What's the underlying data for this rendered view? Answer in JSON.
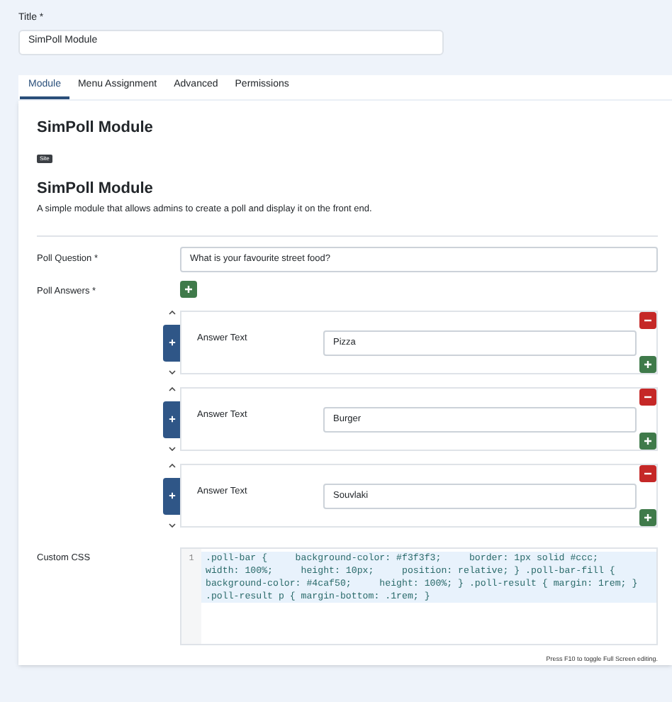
{
  "title_field": {
    "label": "Title *",
    "value": "SimPoll Module"
  },
  "tabs": [
    {
      "label": "Module",
      "selected": true
    },
    {
      "label": "Menu Assignment",
      "selected": false
    },
    {
      "label": "Advanced",
      "selected": false
    },
    {
      "label": "Permissions",
      "selected": false
    }
  ],
  "module": {
    "heading": "SimPoll Module",
    "badge": "Site",
    "subheading": "SimPoll Module",
    "description": "A simple module that allows admins to create a poll and display it on the front end."
  },
  "poll_question": {
    "label": "Poll Question *",
    "value": "What is your favourite street food?"
  },
  "poll_answers": {
    "label": "Poll Answers *",
    "items": [
      {
        "label": "Answer Text",
        "value": "Pizza"
      },
      {
        "label": "Answer Text",
        "value": "Burger"
      },
      {
        "label": "Answer Text",
        "value": "Souvlaki"
      }
    ]
  },
  "custom_css": {
    "label": "Custom CSS",
    "line_number": "1",
    "code": ".poll-bar {     background-color: #f3f3f3;     border: 1px solid #ccc;     width: 100%;     height: 10px;     position: relative; } .poll-bar-fill {     background-color: #4caf50;     height: 100%; } .poll-result { margin: 1rem; } .poll-result p { margin-bottom: .1rem; }",
    "hint": "Press F10 to toggle Full Screen editing."
  }
}
